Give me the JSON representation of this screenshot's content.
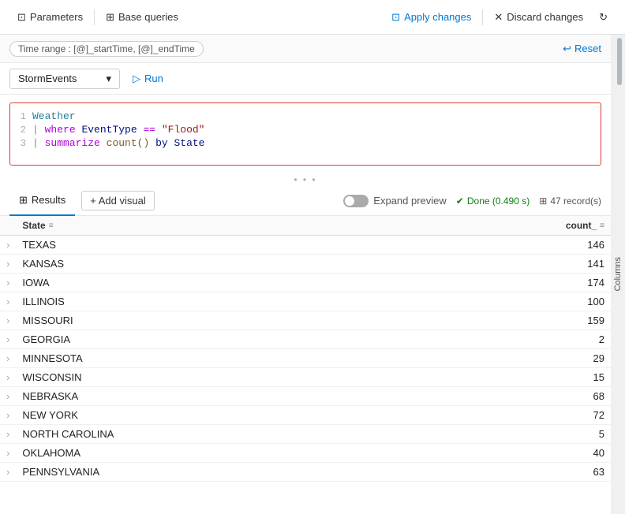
{
  "toolbar": {
    "parameters_label": "Parameters",
    "base_queries_label": "Base queries",
    "apply_changes_label": "Apply changes",
    "discard_changes_label": "Discard changes"
  },
  "time_range": {
    "label": "Time range",
    "value": "[@]_startTime, [@]_endTime",
    "reset_label": "Reset"
  },
  "query_bar": {
    "database": "StormEvents",
    "run_label": "Run"
  },
  "code": {
    "lines": [
      {
        "num": 1,
        "parts": [
          {
            "text": "Weather",
            "type": "table"
          }
        ]
      },
      {
        "num": 2,
        "parts": [
          {
            "text": "| ",
            "type": "pipe"
          },
          {
            "text": "where",
            "type": "kw_op"
          },
          {
            "text": " EventType ",
            "type": "prop"
          },
          {
            "text": "==",
            "type": "kw_op"
          },
          {
            "text": " \"Flood\"",
            "type": "string"
          }
        ]
      },
      {
        "num": 3,
        "parts": [
          {
            "text": "| ",
            "type": "pipe"
          },
          {
            "text": "summarize",
            "type": "kw_op"
          },
          {
            "text": " ",
            "type": "prop"
          },
          {
            "text": "count()",
            "type": "func"
          },
          {
            "text": " by State",
            "type": "prop"
          }
        ]
      }
    ]
  },
  "results": {
    "tab_label": "Results",
    "add_visual_label": "+ Add visual",
    "expand_preview_label": "Expand preview",
    "done_label": "Done (0.490 s)",
    "records_label": "47 record(s)"
  },
  "table": {
    "columns": [
      "State",
      "count_"
    ],
    "rows": [
      {
        "state": "TEXAS",
        "count": 146
      },
      {
        "state": "KANSAS",
        "count": 141
      },
      {
        "state": "IOWA",
        "count": 174
      },
      {
        "state": "ILLINOIS",
        "count": 100
      },
      {
        "state": "MISSOURI",
        "count": 159
      },
      {
        "state": "GEORGIA",
        "count": 2
      },
      {
        "state": "MINNESOTA",
        "count": 29
      },
      {
        "state": "WISCONSIN",
        "count": 15
      },
      {
        "state": "NEBRASKA",
        "count": 68
      },
      {
        "state": "NEW YORK",
        "count": 72
      },
      {
        "state": "NORTH CAROLINA",
        "count": 5
      },
      {
        "state": "OKLAHOMA",
        "count": 40
      },
      {
        "state": "PENNSYLVANIA",
        "count": 63
      }
    ]
  },
  "sidebar": {
    "columns_label": "Columns"
  }
}
